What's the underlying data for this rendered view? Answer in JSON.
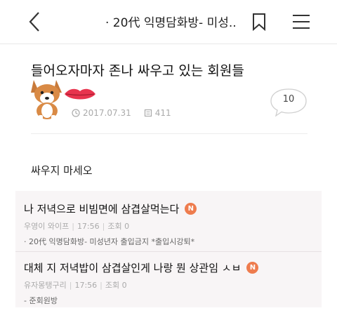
{
  "header": {
    "title": "· 20代 익명담화방- 미성..",
    "back_icon": "chevron-left-icon",
    "bookmark_icon": "bookmark-icon",
    "menu_icon": "hamburger-menu-icon"
  },
  "post": {
    "title": "들어오자마자 존나 싸우고 있는 회원들",
    "date": "2017.07.31",
    "views": "411",
    "comment_count": "10",
    "body": "싸우지 마세오"
  },
  "related": [
    {
      "title": "나 저녁으로 비빔면에 삼겹살먹는다",
      "badge": "N",
      "author": "우영이 와이프",
      "time": "17:56",
      "views": "조회 0",
      "board": "· 20代 익명담화방- 미성년자 출입금지 *출입시강퇴*"
    },
    {
      "title": "대체 지 저녁밥이 삼겹살인게 나랑 뭔 상관임 ㅅㅂ",
      "badge": "N",
      "author": "유자몽탱구리",
      "time": "17:56",
      "views": "조회 0",
      "board": "- 준회원방"
    }
  ],
  "colors": {
    "badge": "#ee7c4e",
    "list_bg": "#f8f5f6",
    "meta_text": "#aaaaaa"
  }
}
